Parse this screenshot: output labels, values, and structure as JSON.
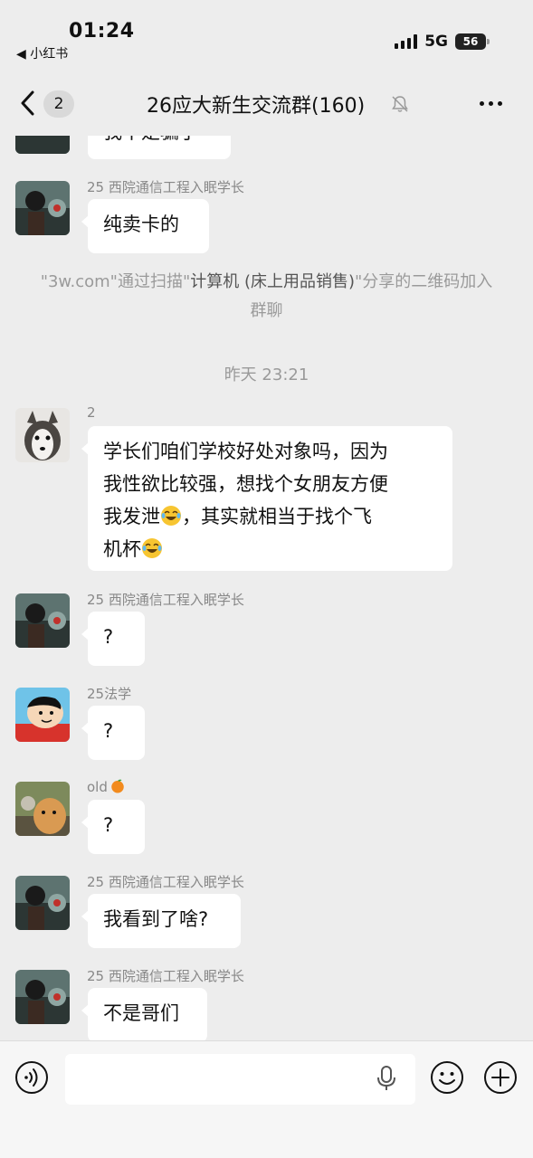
{
  "status_bar": {
    "time": "01:24",
    "back_app": "◀ 小红书",
    "network": "5G",
    "battery": "56"
  },
  "nav": {
    "unread_badge": "2",
    "title": "26应大新生交流群(160)"
  },
  "messages": [
    {
      "sender": "",
      "text": "我不是骗了"
    },
    {
      "sender": "25 西院通信工程入眠学长",
      "text": "纯卖卡的"
    },
    {
      "system": {
        "parts": [
          "\"3w.com\"通过扫描\"",
          "计算机 (床上用品销售)",
          "\"分享的二维码加入群聊"
        ]
      }
    },
    {
      "timestamp": "昨天 23:21"
    },
    {
      "sender": "2",
      "lines": [
        "学长们咱们学校好处对象吗，因为",
        "我性欲比较强，想找个女朋友方便",
        "我发泄",
        "，其实就相当于找个飞",
        "机杯"
      ]
    },
    {
      "sender": "25 西院通信工程入眠学长",
      "text": "?"
    },
    {
      "sender": "25法学",
      "text": "?"
    },
    {
      "sender": "old",
      "text": "?"
    },
    {
      "sender": "25 西院通信工程入眠学长",
      "text": "我看到了啥?"
    },
    {
      "sender": "25 西院通信工程入眠学长",
      "text": "不是哥们"
    }
  ],
  "input_bar": {
    "placeholder": ""
  },
  "icons": {
    "back": "chevron-left-icon",
    "mute": "mute-bell-icon",
    "more": "more-dots-icon",
    "voice": "voice-icon",
    "mic": "microphone-icon",
    "emoji": "emoji-icon",
    "plus": "plus-icon",
    "laugh_cry": "laughing-tears-emoji",
    "orange": "orange-emoji"
  },
  "colors": {
    "background": "#ededed",
    "bubble": "#ffffff",
    "sender_name": "#888888",
    "system_text": "#9a9a9a"
  }
}
